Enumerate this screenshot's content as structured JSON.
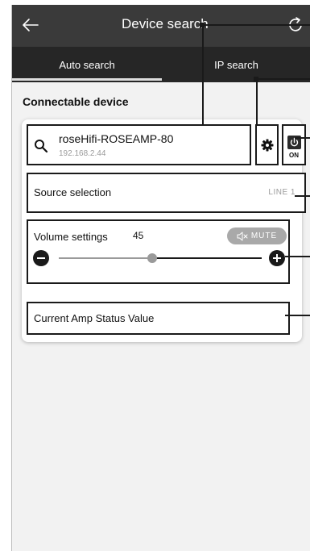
{
  "header": {
    "title": "Device search",
    "back_icon": "back-arrow-icon",
    "refresh_icon": "refresh-icon"
  },
  "tabs": [
    {
      "label": "Auto search",
      "active": true
    },
    {
      "label": "IP search",
      "active": false
    }
  ],
  "section": {
    "title": "Connectable device"
  },
  "device": {
    "name": "roseHifi-ROSEAMP-80",
    "ip": "192.168.2.44",
    "search_icon": "search-icon",
    "settings_icon": "gear-icon",
    "power_icon": "power-icon",
    "power_label": "ON"
  },
  "source": {
    "label": "Source selection",
    "value": "LINE 1"
  },
  "volume": {
    "label": "Volume settings",
    "value": "45",
    "mute_label": "MUTE",
    "mute_icon": "speaker-mute-icon",
    "level": 0.4
  },
  "status": {
    "label": "Current Amp Status Value"
  },
  "colors": {
    "header_bg": "#3a3a3a",
    "tabs_bg": "#262626",
    "screen_bg": "#f2f2f2",
    "mute_bg": "#a9a9a9",
    "outline": "#1a1a1a"
  }
}
